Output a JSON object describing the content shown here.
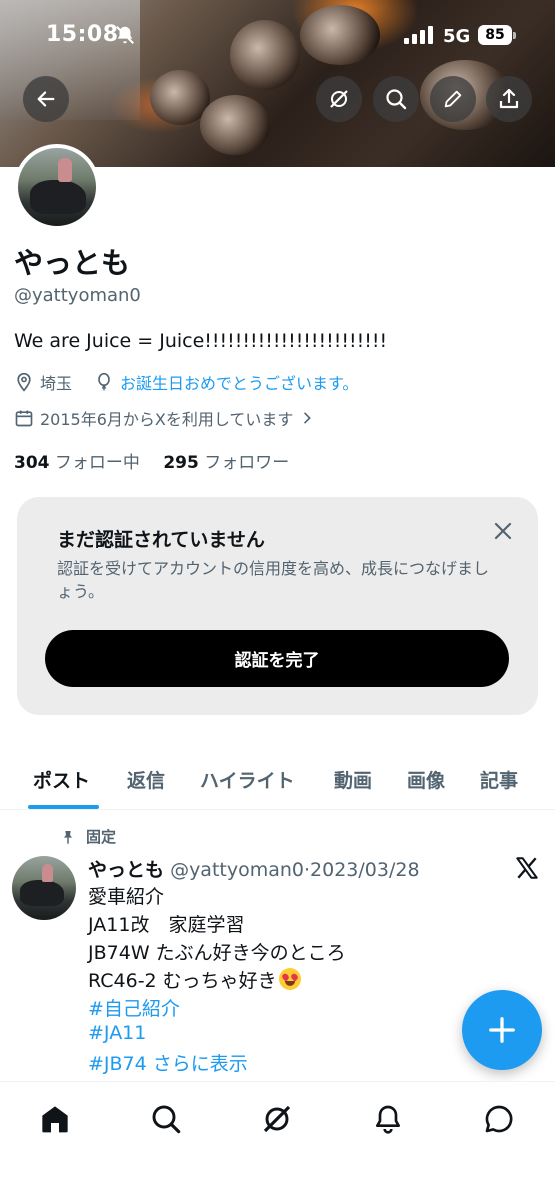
{
  "status_bar": {
    "time": "15:08",
    "network": "5G",
    "battery": "85"
  },
  "header": {
    "icons": [
      "back-arrow-icon",
      "grok-icon",
      "search-icon",
      "edit-pencil-icon",
      "share-icon"
    ]
  },
  "profile": {
    "name": "やっとも",
    "handle": "@yattyoman0",
    "bio": "We are Juice = Juice!!!!!!!!!!!!!!!!!!!!!!!!",
    "location": "埼玉",
    "birthday_text": "お誕生日おめでとうございます。",
    "joined": "2015年6月からXを利用しています",
    "following_count": "304",
    "following_label": "フォロー中",
    "followers_count": "295",
    "followers_label": "フォロワー"
  },
  "verification": {
    "title": "まだ認証されていません",
    "description": "認証を受けてアカウントの信用度を高め、成長につなげましょう。",
    "button": "認証を完了"
  },
  "tabs": [
    "ポスト",
    "返信",
    "ハイライト",
    "動画",
    "画像",
    "記事"
  ],
  "active_tab": "ポスト",
  "post": {
    "pinned_label": "固定",
    "author_name": "やっとも",
    "author_handle": "@yattyoman0",
    "separator": "·",
    "date": "2023/03/28",
    "lines": [
      "愛車紹介",
      "JA11改　家庭学習",
      "JB74W  たぶん好き今のところ",
      "RC46-2 むっちゃ好き"
    ],
    "emoji": "heart-eyes-emoji",
    "hashtags": [
      "#自己紹介",
      "#JA11",
      "#JB74"
    ],
    "show_more": "さらに表示"
  },
  "colors": {
    "accent": "#1d9bf0",
    "text": "#0f1419",
    "muted": "#536471",
    "card_bg": "#ececec"
  },
  "bottom_nav": [
    "home-icon",
    "search-icon",
    "grok-icon",
    "notifications-bell-icon",
    "messages-icon"
  ]
}
